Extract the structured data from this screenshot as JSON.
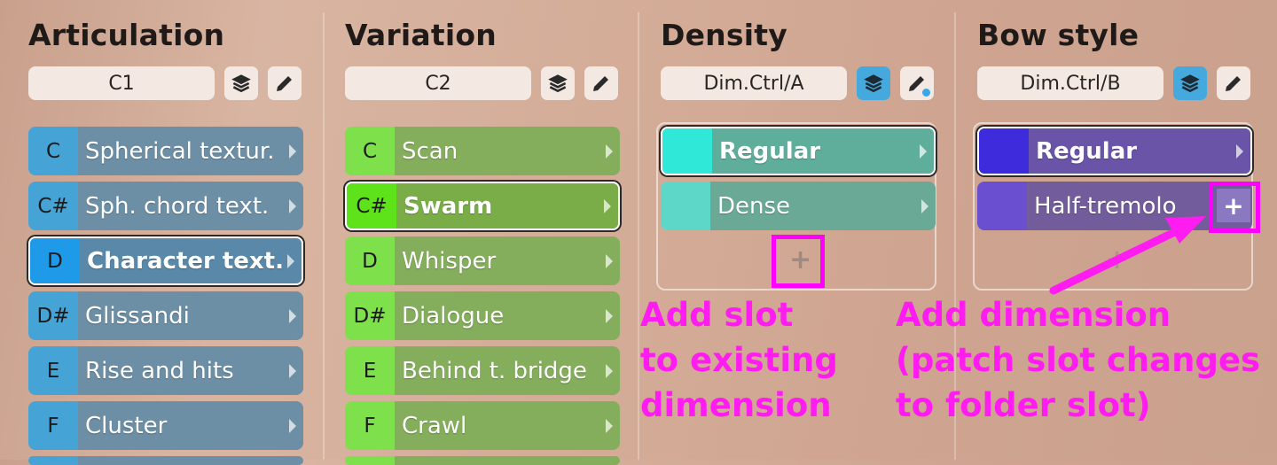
{
  "columns": {
    "articulation": {
      "title": "Articulation",
      "param": "C1",
      "slots": [
        {
          "key": "C",
          "name": "Spherical textur."
        },
        {
          "key": "C#",
          "name": "Sph. chord text."
        },
        {
          "key": "D",
          "name": "Character text."
        },
        {
          "key": "D#",
          "name": "Glissandi"
        },
        {
          "key": "E",
          "name": "Rise and hits"
        },
        {
          "key": "F",
          "name": "Cluster"
        }
      ]
    },
    "variation": {
      "title": "Variation",
      "param": "C2",
      "slots": [
        {
          "key": "C",
          "name": "Scan"
        },
        {
          "key": "C#",
          "name": "Swarm"
        },
        {
          "key": "D",
          "name": "Whisper"
        },
        {
          "key": "D#",
          "name": "Dialogue"
        },
        {
          "key": "E",
          "name": "Behind t. bridge"
        },
        {
          "key": "F",
          "name": "Crawl"
        }
      ]
    },
    "density": {
      "title": "Density",
      "param": "Dim.Ctrl/A",
      "slots": [
        {
          "name": "Regular"
        },
        {
          "name": "Dense"
        }
      ],
      "add_slot": "+"
    },
    "bow_style": {
      "title": "Bow style",
      "param": "Dim.Ctrl/B",
      "slots": [
        {
          "name": "Regular"
        },
        {
          "name": "Half-tremolo"
        }
      ],
      "add_dimension": "+",
      "add_slot": "+"
    }
  },
  "annotations": {
    "add_slot": "Add slot\nto existing\ndimension",
    "add_dimension": "Add dimension\n(patch slot changes\nto folder slot)"
  },
  "colors": {
    "articulation_key": "#45a3d6",
    "articulation_key_selected": "#1e9ae8",
    "articulation_name": "#6d8fa6",
    "variation_key": "#7ee04a",
    "variation_key_selected": "#5ee21a",
    "variation_name": "#84ad5c",
    "density_swatch": "#2fe8d8",
    "density_name": "#5fae9c",
    "bow_swatch": "#3d2bdc",
    "bow_name": "#6a54a8",
    "annotation": "#ff1cf0"
  }
}
